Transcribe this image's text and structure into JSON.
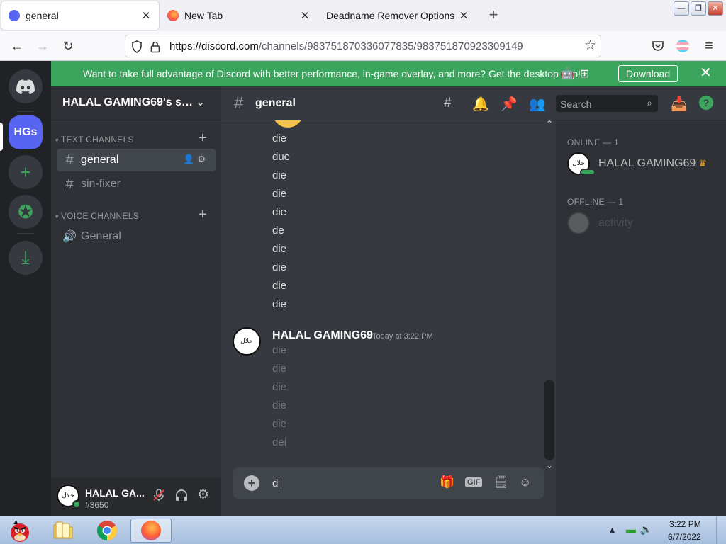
{
  "browser": {
    "tabs": [
      {
        "title": "general",
        "active": true
      },
      {
        "title": "New Tab",
        "active": false
      },
      {
        "title": "Deadname Remover Options",
        "active": false
      }
    ],
    "close_glyph": "✕",
    "new_tab_glyph": "+",
    "window_buttons": {
      "minimize": "—",
      "restore": "❐",
      "close": "✕"
    },
    "url_host": "https://discord.com",
    "url_path": "/channels/983751870336077835/983751870923309149",
    "nav_glyphs": {
      "back": "←",
      "forward": "→",
      "reload": "↻",
      "bookmark": "☆",
      "menu": "≡"
    }
  },
  "banner": {
    "text": "Want to take full advantage of Discord with better performance, in-game overlay, and more? Get the desktop app!",
    "download_label": "Download",
    "close_glyph": "✕"
  },
  "guilds": {
    "active_abbr": "HGs",
    "add_glyph": "+",
    "explore_glyph": "✪",
    "download_glyph": "⤓"
  },
  "sidebar": {
    "server_name": "HALAL GAMING69's server",
    "text_category": "TEXT CHANNELS",
    "voice_category": "VOICE CHANNELS",
    "text_channels": [
      "general",
      "sin-fixer"
    ],
    "voice_channels": [
      "General"
    ],
    "selected_channel": "general"
  },
  "user_panel": {
    "name": "HALAL GA...",
    "tag": "#3650"
  },
  "chat": {
    "channel_name": "general",
    "search_placeholder": "Search",
    "previous_lines": [
      "die",
      "due",
      "die",
      "die",
      "die",
      "de",
      "die",
      "die",
      "die",
      "die"
    ],
    "message": {
      "author": "HALAL GAMING69",
      "timestamp": "Today at 3:22 PM",
      "pending_lines": [
        "die",
        "die",
        "die",
        "die",
        "die",
        "dei"
      ]
    },
    "composer_value": "d",
    "gif_label": "GIF"
  },
  "members": {
    "online_header": "ONLINE — 1",
    "offline_header": "OFFLINE — 1",
    "online": [
      {
        "name": "HALAL GAMING69",
        "owner": true
      }
    ],
    "offline": [
      {
        "name": "activity"
      }
    ]
  },
  "avatar_text": "حلال",
  "taskbar": {
    "time": "3:22 PM",
    "date": "6/7/2022"
  },
  "colors": {
    "discord_blurple": "#5865f2",
    "discord_green": "#3ba55d",
    "chat_bg": "#36393f",
    "sidebar_bg": "#2f3136",
    "guild_bg": "#202225"
  }
}
